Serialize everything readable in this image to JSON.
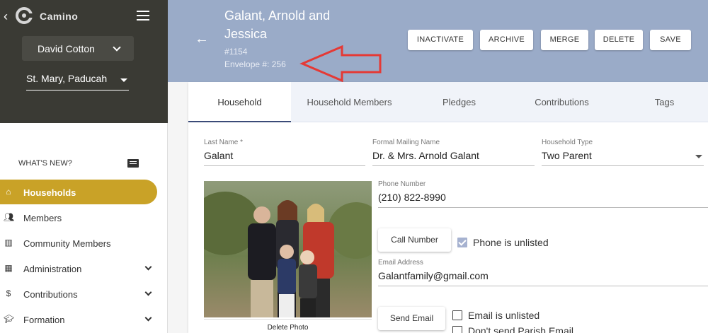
{
  "app": {
    "name": "Camino"
  },
  "sidebar": {
    "user": "David Cotton",
    "parish": "St. Mary, Paducah",
    "whats_new": "WHAT'S NEW?",
    "items": [
      {
        "label": "Households",
        "icon": "home-icon"
      },
      {
        "label": "Members",
        "icon": "people-icon"
      },
      {
        "label": "Community Members",
        "icon": "building-icon"
      },
      {
        "label": "Administration",
        "icon": "grid-icon"
      },
      {
        "label": "Contributions",
        "icon": "dollar-icon"
      },
      {
        "label": "Formation",
        "icon": "school-icon"
      }
    ]
  },
  "header": {
    "title": "Galant, Arnold and Jessica",
    "number": "#1154",
    "envelope": "Envelope #: 256",
    "buttons": {
      "inactivate": "INACTIVATE",
      "archive": "ARCHIVE",
      "merge": "MERGE",
      "delete": "DELETE",
      "save": "SAVE"
    }
  },
  "tabs": [
    "Household",
    "Household Members",
    "Pledges",
    "Contributions",
    "Tags"
  ],
  "form": {
    "last_name": {
      "label": "Last Name *",
      "value": "Galant"
    },
    "formal_mailing_name": {
      "label": "Formal Mailing Name",
      "value": "Dr. & Mrs. Arnold Galant"
    },
    "household_type": {
      "label": "Household Type",
      "value": "Two Parent"
    },
    "phone": {
      "label": "Phone Number",
      "value": "(210) 822-8990"
    },
    "call_button": "Call Number",
    "phone_unlisted": "Phone is unlisted",
    "email": {
      "label": "Email Address",
      "value": "Galantfamily@gmail.com"
    },
    "send_email": "Send Email",
    "email_unlisted": "Email is unlisted",
    "dont_send_parish_email": "Don't send Parish Email",
    "delete_photo": "Delete Photo"
  },
  "colors": {
    "sidebar_dark": "#3a3a34",
    "accent_gold": "#c9a227",
    "header_blue": "#9aabc8",
    "annotation_red": "#e53935"
  }
}
